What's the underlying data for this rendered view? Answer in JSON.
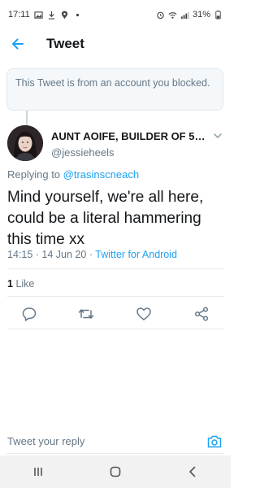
{
  "status_bar": {
    "time": "17:11",
    "battery": "31%",
    "left_icons": [
      "gallery-icon",
      "download-icon",
      "location-icon",
      "dot-icon"
    ],
    "right_icons": [
      "alarm-icon",
      "wifi-icon",
      "signal-icon",
      "battery-icon"
    ]
  },
  "header": {
    "title": "Tweet"
  },
  "notice": {
    "text": "This Tweet is from an account you blocked."
  },
  "tweet": {
    "display_name": "AUNT AOIFE, BUILDER OF 5G/...",
    "username": "@jessieheels",
    "replying_prefix": "Replying to",
    "replying_to": "@trasinscneach",
    "text": "Mind yourself, we're all here, could be a literal hammering this time xx",
    "time": "14:15",
    "date": "14 Jun 20",
    "source": "Twitter for Android",
    "like_count": "1",
    "like_label": "Like"
  },
  "reply": {
    "placeholder": "Tweet your reply"
  },
  "colors": {
    "accent": "#1da1f2",
    "secondary_text": "#657786",
    "primary_text": "#14171a"
  }
}
